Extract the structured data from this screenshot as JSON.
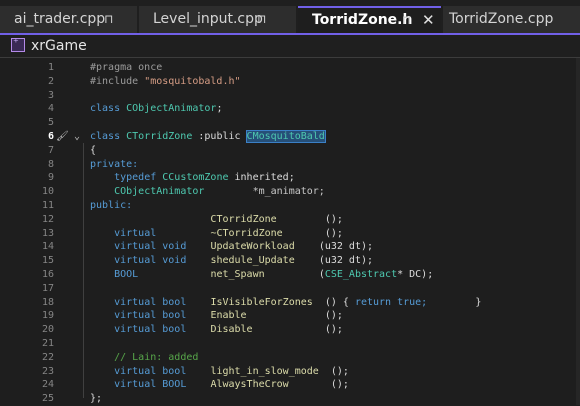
{
  "tabs": [
    {
      "label": "ai_trader.cpp",
      "pin": "⊓",
      "active": false
    },
    {
      "label": "Level_input.cpp",
      "pin": "⊓",
      "active": false
    },
    {
      "label": "TorridZone.h",
      "pin": "⊓",
      "close": "✕",
      "active": true
    },
    {
      "label": "TorridZone.cpp",
      "active": false
    }
  ],
  "project": {
    "name": "xrGame",
    "icon": "project-icon"
  },
  "editor": {
    "current_line": "6",
    "lines": [
      {
        "n": "1"
      },
      {
        "n": "2"
      },
      {
        "n": "3"
      },
      {
        "n": "4"
      },
      {
        "n": "5"
      },
      {
        "n": "6"
      },
      {
        "n": "7"
      },
      {
        "n": "8"
      },
      {
        "n": "9"
      },
      {
        "n": "10"
      },
      {
        "n": "11"
      },
      {
        "n": "12"
      },
      {
        "n": "13"
      },
      {
        "n": "14"
      },
      {
        "n": "15"
      },
      {
        "n": "16"
      },
      {
        "n": "17"
      },
      {
        "n": "18"
      },
      {
        "n": "19"
      },
      {
        "n": "20"
      },
      {
        "n": "21"
      },
      {
        "n": "22"
      },
      {
        "n": "23"
      },
      {
        "n": "24"
      },
      {
        "n": "25"
      }
    ],
    "tokens": {
      "l1": [
        "#pragma once"
      ],
      "l2": [
        "#include ",
        "\"mosquitobald.h\""
      ],
      "l4": [
        "class ",
        "CObjectAnimator",
        ";"
      ],
      "l6": [
        "class ",
        "CTorridZone",
        " :public ",
        "CMosquitoBald"
      ],
      "l7": [
        "{"
      ],
      "l8": [
        "private:"
      ],
      "l9": [
        "typedef ",
        "CCustomZone",
        " inherited;"
      ],
      "l10": [
        "CObjectAnimator",
        "*m_animator;"
      ],
      "l11": [
        "public:"
      ],
      "l12": [
        "CTorridZone",
        "();"
      ],
      "l13": [
        "virtual",
        "~CTorridZone",
        "();"
      ],
      "l14": [
        "virtual void",
        "UpdateWorkload",
        "(u32 dt);"
      ],
      "l15": [
        "virtual void",
        "shedule_Update",
        "(u32 dt);"
      ],
      "l16": [
        "BOOL",
        "net_Spawn",
        "(",
        "CSE_Abstract",
        "* DC);"
      ],
      "l18": [
        "virtual bool",
        "IsVisibleForZones",
        "() { ",
        "return",
        " true;",
        "}"
      ],
      "l19": [
        "virtual bool",
        "Enable",
        "();"
      ],
      "l20": [
        "virtual bool",
        "Disable",
        "();"
      ],
      "l22": [
        "// Lain: added"
      ],
      "l23": [
        "virtual bool",
        "light_in_slow_mode",
        "();"
      ],
      "l24": [
        "virtual BOOL",
        "AlwaysTheCrow",
        "();"
      ],
      "l25": [
        "};"
      ]
    }
  },
  "colors": {
    "accent": "#7160e8",
    "keyword": "#569cd6",
    "type": "#4ec9b0",
    "string": "#d69d85",
    "function": "#dcdcaa",
    "comment": "#57a64a"
  }
}
